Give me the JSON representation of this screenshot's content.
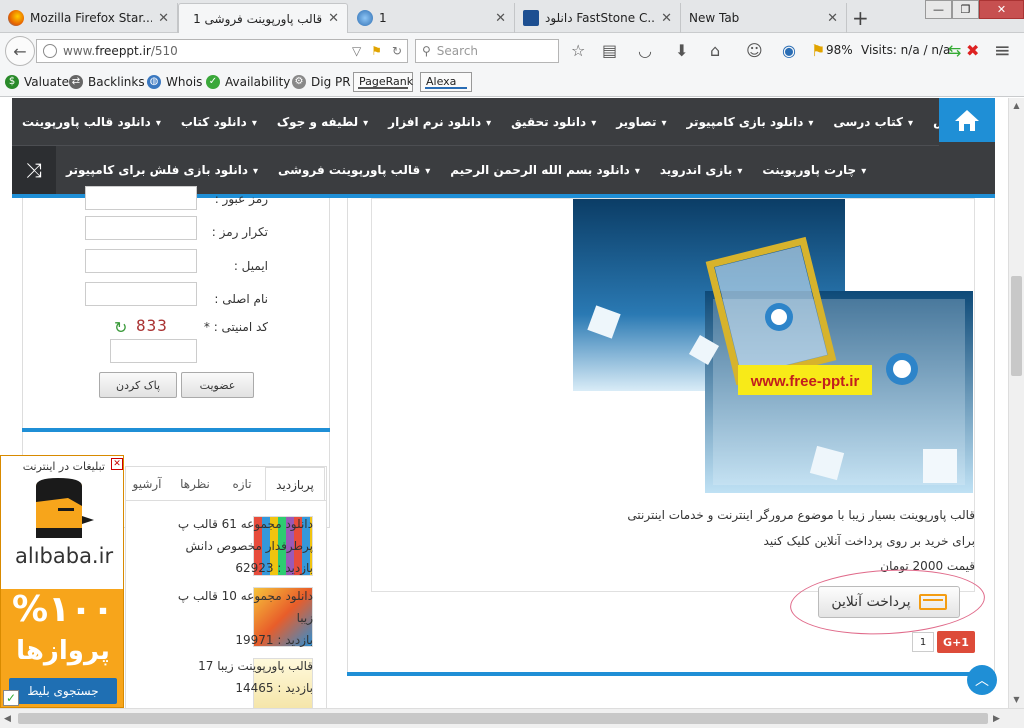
{
  "tabs": [
    {
      "label": "Mozilla Firefox Star...",
      "icon": "firefox-icon"
    },
    {
      "label": "قالب پاورپوینت فروشی 1",
      "icon": "page-icon"
    },
    {
      "label": "1",
      "icon": "globe-icon"
    },
    {
      "label": "دانلود FastStone C...",
      "icon": "faststone-icon"
    },
    {
      "label": "New Tab",
      "icon": ""
    }
  ],
  "window": {
    "min": "—",
    "max": "❐",
    "close": "✕"
  },
  "url": {
    "prefix": "www.",
    "domain": "freeppt.ir",
    "path": "/510"
  },
  "search": {
    "placeholder": "Search"
  },
  "toolbar": {
    "zoom": "98%",
    "visits": "Visits: n/a / n/a"
  },
  "bookmarks": [
    {
      "label": "Valuate",
      "icon": "dollar-icon"
    },
    {
      "label": "Backlinks",
      "icon": "backlinks-icon"
    },
    {
      "label": "Whois",
      "icon": "whois-icon"
    },
    {
      "label": "Availability",
      "icon": "availability-icon"
    },
    {
      "label": "Dig PR",
      "icon": "digpr-icon"
    },
    {
      "label": "PageRank",
      "icon": ""
    },
    {
      "label": "Alexa",
      "icon": ""
    }
  ],
  "nav": {
    "row1": [
      "دانلود قالب پاورپوینت",
      "دانلود کتاب",
      "لطیفه و جوک",
      "دانلود نرم افزار",
      "دانلود تحقیق",
      "تصاویر",
      "دانلود بازی کامپیوتر",
      "کتاب درسی",
      "آموزش"
    ],
    "row1_dropdown": [
      true,
      true,
      true,
      true,
      true,
      true,
      true,
      true,
      true
    ],
    "row2": [
      "دانلود بازی فلش برای کامپیوتر",
      "قالب پاورپوینت فروشی",
      "دانلود بسم الله الرحمن الرحیم",
      "بازی اندروید",
      "چارت پاورپوینت"
    ],
    "row2_dropdown": [
      true,
      true,
      true,
      true,
      true
    ]
  },
  "product": {
    "banner_text": "www.free-ppt.ir",
    "desc_line1": "قالب پاورپوینت بسیار زیبا با موضوع مرورگر اینترنت و خدمات اینترنتی",
    "desc_line2": "برای خرید بر روی پرداخت آنلاین کلیک کنید",
    "price": "قیمت 2000 تومان",
    "pay_label": "پرداخت آنلاین",
    "gplus": "G+1",
    "gcount": "1"
  },
  "form": {
    "password": "رمز عبور :",
    "repeat": "تکرار رمز :",
    "email": "ایمیل :",
    "name": "نام اصلی :",
    "captcha_label": "کد امنیتی : *",
    "captcha_value": "833",
    "register": "عضویت",
    "clear": "پاک کردن"
  },
  "widget": {
    "tabs": [
      "پربازدید",
      "تازه",
      "نظرها",
      "آرشیو"
    ],
    "items": [
      {
        "line1": "دانلود مجموعه 61 قالب پ",
        "line2": "پرطرفدار مخصوص دانش",
        "visits": "بازدید : 62923"
      },
      {
        "line1": "دانلود مجموعه 10 قالب پ",
        "line2": "زیبا",
        "visits": "بازدید : 19971"
      },
      {
        "line1": "قالب پاورپوینت زیبا 17",
        "line2": "",
        "visits": "بازدید : 14465"
      }
    ]
  },
  "ad": {
    "title": "تبلیغات در اینترنت",
    "brand": "alıbaba.ir",
    "big": "%۱۰۰",
    "sub": "پروازها",
    "cta": "جستجوی بلیط"
  },
  "colors": {
    "accent": "#1f8fd6",
    "nav": "#3b3d40",
    "gplus": "#dd4b39",
    "ad": "#f7a51b"
  }
}
